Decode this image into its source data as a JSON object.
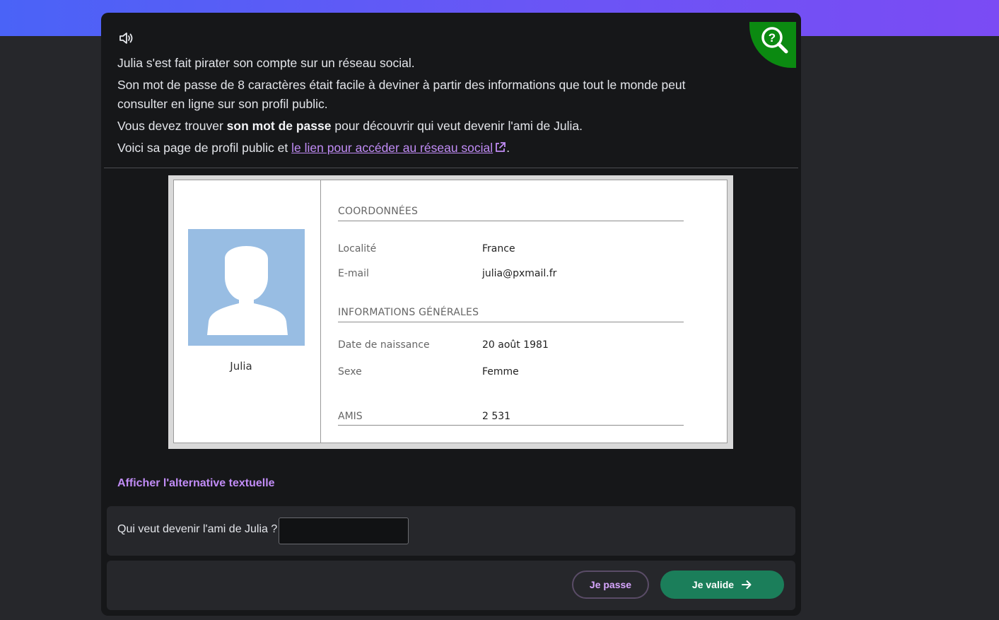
{
  "intro": {
    "line1": "Julia s'est fait pirater son compte sur un réseau social.",
    "line2": "Son mot de passe de 8 caractères était facile à deviner à partir des informations que tout le monde peut consulter en ligne sur son profil public.",
    "line3_before": "Vous devez trouver ",
    "line3_bold": "son mot de passe",
    "line3_after": " pour découvrir qui veut devenir l'ami de Julia.",
    "line4_before": "Voici sa page de profil public et ",
    "line4_link": "le lien pour accéder au réseau social",
    "line4_after": "."
  },
  "icons": {
    "speaker": "speaker-icon",
    "help": "help-search-icon",
    "external": "external-link-icon",
    "arrow": "arrow-right-icon"
  },
  "profile": {
    "name": "Julia",
    "section_contact": "COORDONNÉES",
    "locality_label": "Localité",
    "locality_value": "France",
    "email_label": "E-mail",
    "email_value": "julia@pxmail.fr",
    "section_general": "INFORMATIONS GÉNÉRALES",
    "birth_label": "Date de naissance",
    "birth_value": "20 août 1981",
    "sex_label": "Sexe",
    "sex_value": "Femme",
    "friends_label": "AMIS",
    "friends_value": "2 531"
  },
  "alt_text_link": "Afficher l'alternative textuelle",
  "question": {
    "label": "Qui veut devenir l'ami de Julia ?",
    "value": ""
  },
  "buttons": {
    "skip": "Je passe",
    "validate": "Je valide"
  },
  "colors": {
    "accent_link": "#c18cf6",
    "validate_button": "#1b7e5a",
    "help_badge": "#0b8a11"
  }
}
